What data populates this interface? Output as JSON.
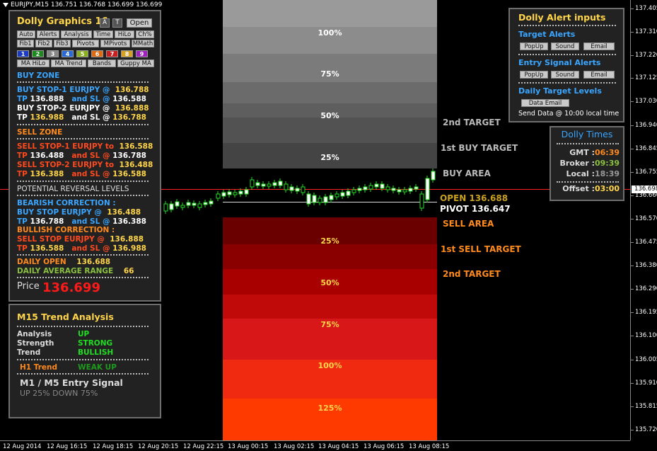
{
  "window": {
    "title": "EURJPY,M15  136.751 136.768 136.699 136.699"
  },
  "buy_zones": [
    {
      "label": "100%"
    },
    {
      "label": "75%"
    },
    {
      "label": "50%"
    },
    {
      "label": "25%"
    }
  ],
  "sell_zones": [
    {
      "label": "25%"
    },
    {
      "label": "50%"
    },
    {
      "label": "75%"
    },
    {
      "label": "100%"
    },
    {
      "label": "125%"
    }
  ],
  "levels": {
    "buy_2nd_target": "2nd TARGET",
    "buy_1st_target": "1st BUY TARGET",
    "buy_area": "BUY AREA",
    "open": "OPEN 136.688",
    "pivot": "PIVOT 136.647",
    "sell_area": "SELL AREA",
    "sell_1st_target": "1st SELL TARGET",
    "sell_2nd_target": "2nd TARGET"
  },
  "graphics_panel": {
    "title": "Dolly Graphics 16",
    "btn_a": "A",
    "btn_t": "T",
    "btn_open": "Open",
    "row1": [
      "Auto",
      "Alerts",
      "Analysis",
      "Time",
      "HiLo",
      "Ch%"
    ],
    "row2": [
      "Fib1",
      "Fib2",
      "Fib3",
      "Pivots",
      "MPivots",
      "MMath"
    ],
    "swatches": [
      "1",
      "2",
      "3",
      "4",
      "5",
      "6",
      "7",
      "8",
      "9"
    ],
    "swatch_colors": [
      "#1c3cc8",
      "#1c8a1c",
      "#888888",
      "#2a6ad8",
      "#8ab020",
      "#e06a10",
      "#c82020",
      "#d8a020",
      "#a020c0"
    ],
    "row3": [
      "MA HiLo",
      "MA Trend",
      "Bands",
      "Guppy MA"
    ],
    "buy_zone_title": "BUY ZONE",
    "buy_stop1": {
      "prefix": "BUY STOP-1  EURJPY  @",
      "price": "136.788",
      "tp_label": "TP",
      "tp": "136.888",
      "sl_label": "and SL @",
      "sl": "136.588"
    },
    "buy_stop2": {
      "prefix": "BUY STOP-2  EURJPY  @",
      "price": "136.888",
      "tp_label": "TP",
      "tp": "136.988",
      "sl_label": "and SL @",
      "sl": "136.788"
    },
    "sell_zone_title": "SELL ZONE",
    "sell_stop1": {
      "prefix": "SELL STOP-1  EURJPY to",
      "price": "136.588",
      "tp_label": "TP",
      "tp": "136.488",
      "sl_label": "and SL @",
      "sl": "136.788"
    },
    "sell_stop2": {
      "prefix": "SELL STOP-2  EURJPY to",
      "price": "136.488",
      "tp_label": "TP",
      "tp": "136.388",
      "sl_label": "and SL @",
      "sl": "136.588"
    },
    "reversal_title": "POTENTIAL REVERSAL LEVELS",
    "bearish_title": "BEARISH CORRECTION :",
    "bearish": {
      "prefix": "BUY STOP EURJPY  @",
      "price": "136.488",
      "tp_label": "TP",
      "tp": "136.788",
      "sl_label": "and SL @",
      "sl": "136.388"
    },
    "bullish_title": "BULLISH CORRECTION :",
    "bullish": {
      "prefix": "SELL STOP EURJPY  @",
      "price": "136.888",
      "tp_label": "TP",
      "tp": "136.588",
      "sl_label": "and SL @",
      "sl": "136.988"
    },
    "daily_open_label": "DAILY OPEN",
    "daily_open": "136.688",
    "dar_label": "DAILY AVERAGE RANGE",
    "dar": "66",
    "price_label": "Price",
    "price": "136.699"
  },
  "trend_panel": {
    "title": "M15 Trend Analysis",
    "rows": [
      {
        "label": "Analysis",
        "value": "UP"
      },
      {
        "label": "Strength",
        "value": "STRONG"
      },
      {
        "label": "Trend",
        "value": "BULLISH"
      }
    ],
    "h1_label": "H1 Trend",
    "h1_value": "WEAK UP",
    "entry_title": "M1 /  M5 Entry Signal",
    "entry_sub": "UP 25%   DOWN 75%"
  },
  "alert_panel": {
    "title": "Dolly Alert inputs",
    "target_title": "Target Alerts",
    "target_btns": [
      "PopUp",
      "Sound",
      "Email"
    ],
    "entry_title": "Entry Signal Alerts",
    "entry_btns": [
      "PopUp",
      "Sound",
      "Email"
    ],
    "daily_title": "Daily Target Levels",
    "data_email": "Data Email",
    "send_text": "Send Data @ 10:00 local time"
  },
  "times_panel": {
    "title": "Dolly Times",
    "gmt_label": "GMT :",
    "gmt": "06:39",
    "broker_label": "Broker :",
    "broker": "09:39",
    "local_label": "Local :",
    "local": "18:39",
    "offset_label": "Offset :",
    "offset": "03:00"
  },
  "price_axis": [
    "137.405",
    "137.310",
    "137.220",
    "137.125",
    "137.030",
    "136.940",
    "136.845",
    "136.755",
    "136.660",
    "136.570",
    "136.475",
    "136.380",
    "136.290",
    "136.195",
    "136.100",
    "136.005",
    "135.910",
    "135.815",
    "135.720"
  ],
  "current_price": "136.698",
  "time_axis": [
    "12 Aug 2014",
    "12 Aug 16:15",
    "12 Aug 18:15",
    "12 Aug 20:15",
    "12 Aug 22:15",
    "13 Aug 00:15",
    "13 Aug 02:15",
    "13 Aug 04:15",
    "13 Aug 06:15",
    "13 Aug 08:15"
  ],
  "colors": {
    "title_yellow": "#ffd54a",
    "buy_blue": "#3aa6ff",
    "sell_orange": "#ff8a1e",
    "sell_red": "#ff4a1e",
    "tp_white": "#ffffff",
    "price_red": "#ff1a1a",
    "green": "#22dd22",
    "gmt_orange": "#ff8a1e",
    "broker_green": "#8ac040"
  }
}
